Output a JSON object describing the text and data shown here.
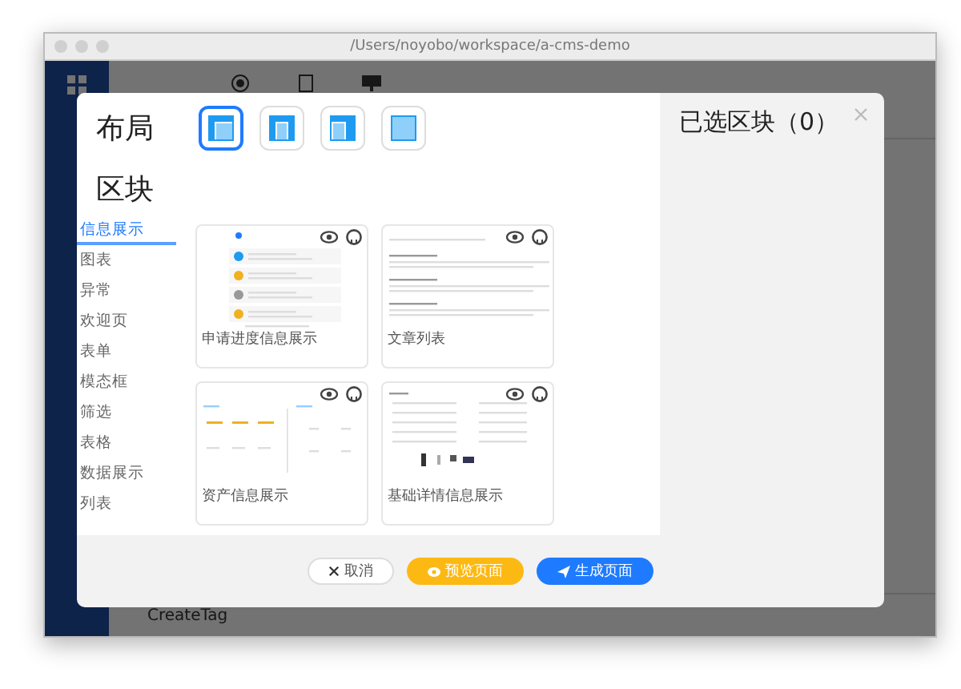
{
  "window": {
    "title": "/Users/noyobo/workspace/a-cms-demo"
  },
  "app": {
    "footer_item": "CreateTag"
  },
  "modal": {
    "layout_heading": "布局",
    "layouts": [
      {
        "kind": "sidebar",
        "selected": true
      },
      {
        "kind": "columns",
        "selected": false
      },
      {
        "kind": "header",
        "selected": false
      },
      {
        "kind": "full",
        "selected": false
      }
    ],
    "block_heading": "区块",
    "categories": [
      {
        "label": "信息展示",
        "selected": true
      },
      {
        "label": "图表",
        "selected": false
      },
      {
        "label": "异常",
        "selected": false
      },
      {
        "label": "欢迎页",
        "selected": false
      },
      {
        "label": "表单",
        "selected": false
      },
      {
        "label": "模态框",
        "selected": false
      },
      {
        "label": "筛选",
        "selected": false
      },
      {
        "label": "表格",
        "selected": false
      },
      {
        "label": "数据展示",
        "selected": false
      },
      {
        "label": "列表",
        "selected": false
      }
    ],
    "blocks": [
      {
        "name": "申请进度信息展示",
        "kind": "steps"
      },
      {
        "name": "文章列表",
        "kind": "articles"
      },
      {
        "name": "资产信息展示",
        "kind": "assets"
      },
      {
        "name": "基础详情信息展示",
        "kind": "details"
      }
    ],
    "selected_heading": "已选区块（0）",
    "buttons": [
      {
        "label": "取消",
        "kind": "cancel"
      },
      {
        "label": "预览页面",
        "kind": "preview"
      },
      {
        "label": "生成页面",
        "kind": "generate"
      }
    ]
  }
}
